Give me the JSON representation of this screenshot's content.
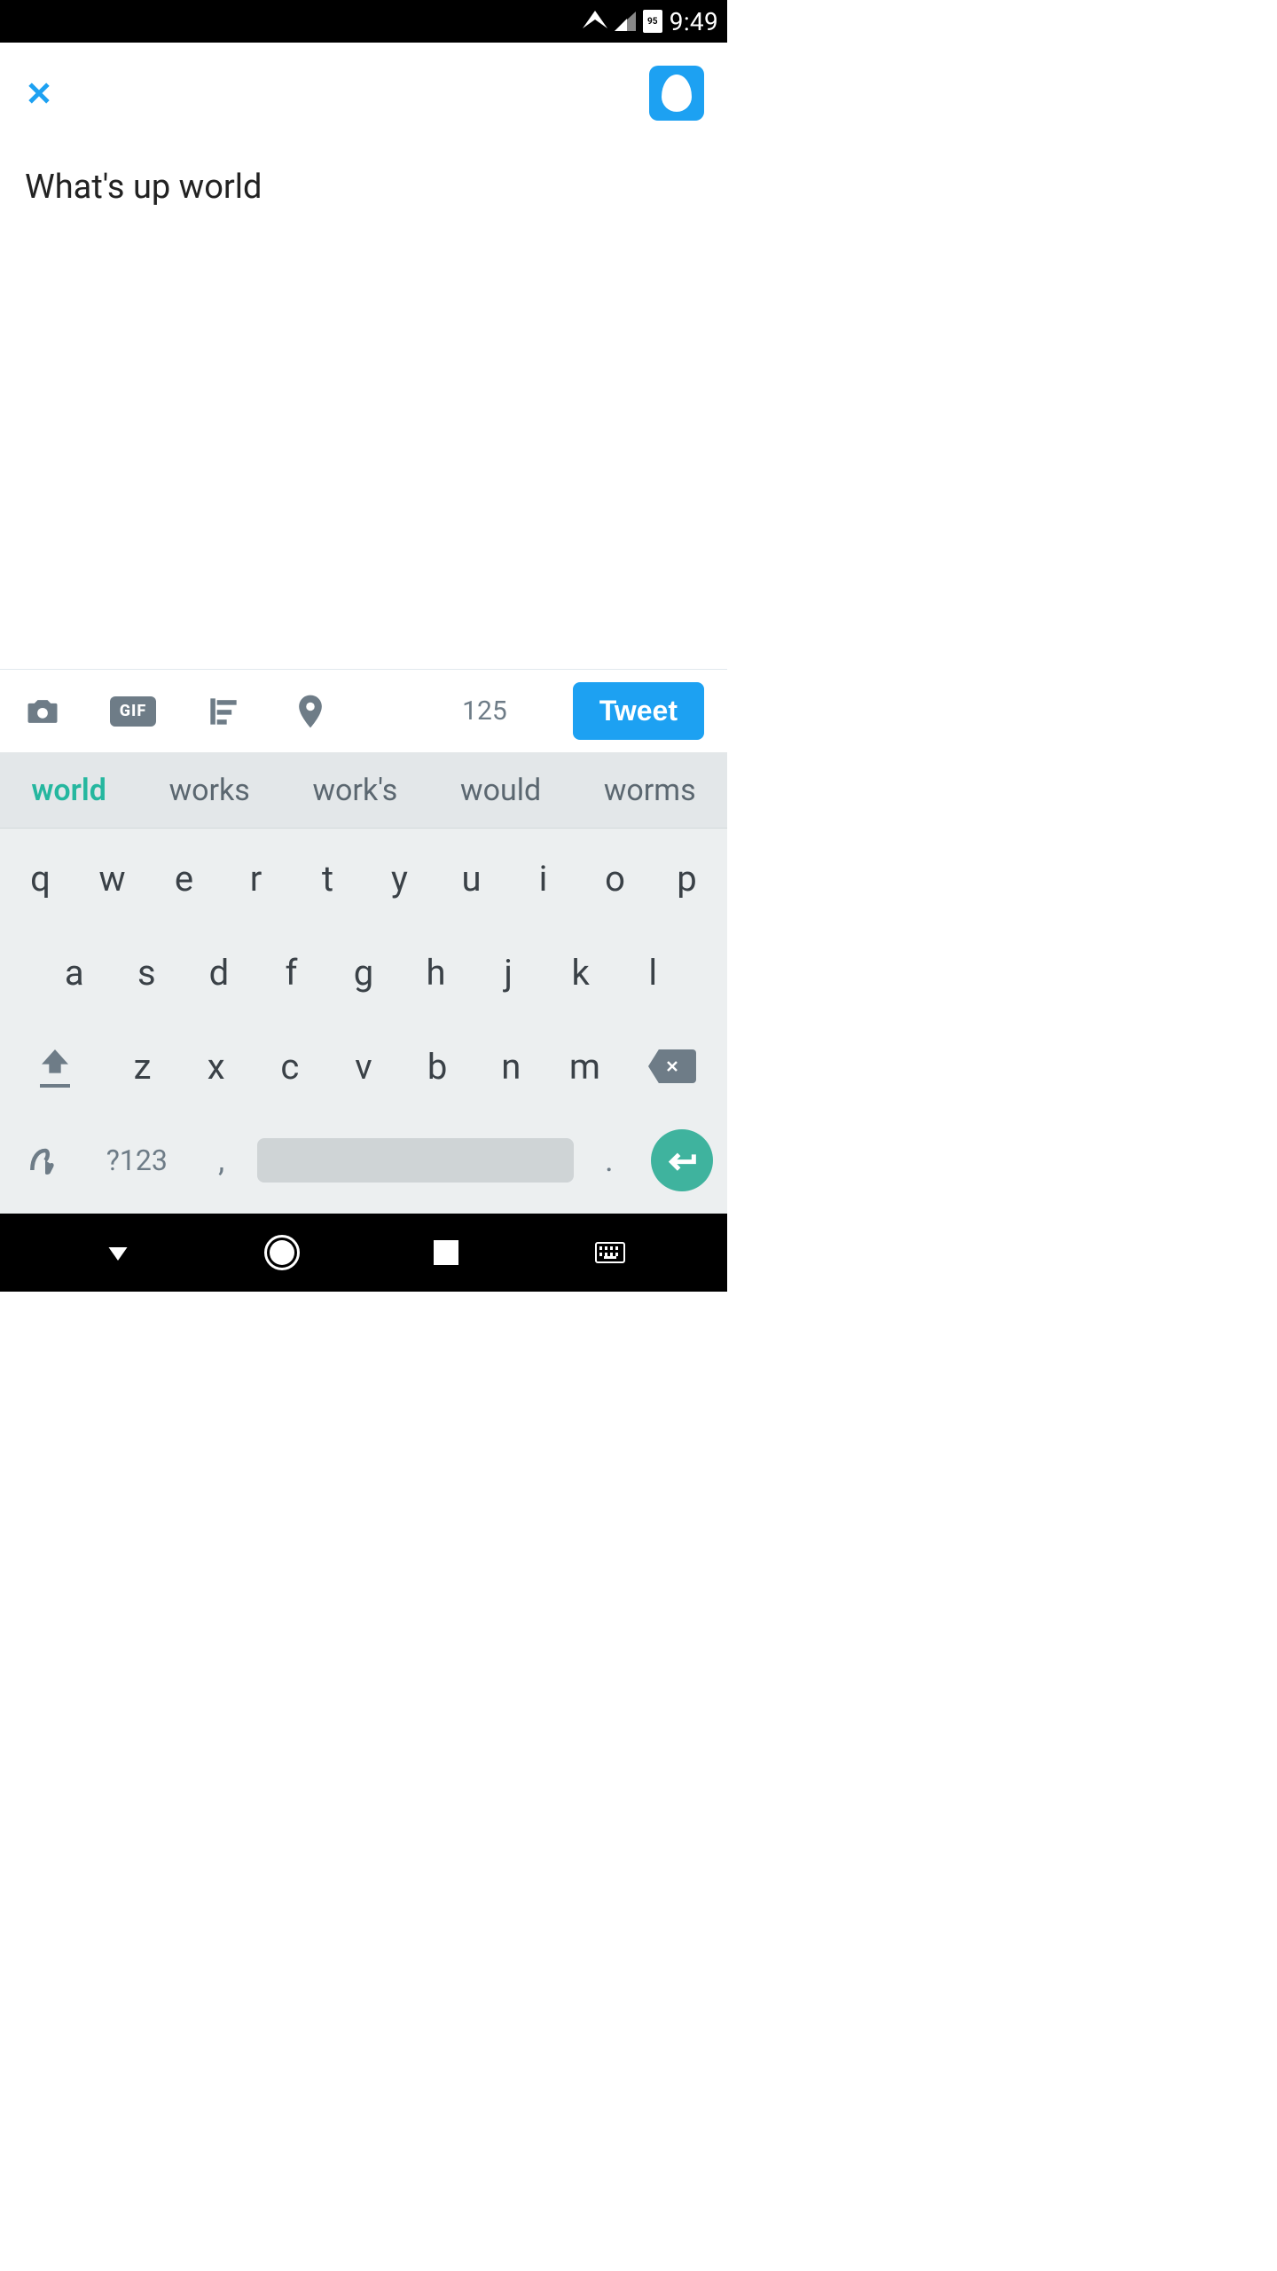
{
  "status_bar": {
    "battery_pct": "95",
    "time": "9:49"
  },
  "header": {
    "close_icon": "close-icon",
    "avatar_icon": "egg-avatar"
  },
  "compose": {
    "text": "What's up world"
  },
  "toolbar": {
    "camera_icon": "camera-icon",
    "gif_label": "GIF",
    "poll_icon": "poll-icon",
    "location_icon": "location-icon",
    "char_count": "125",
    "tweet_label": "Tweet"
  },
  "suggestions": [
    "world",
    "works",
    "work's",
    "would",
    "worms"
  ],
  "keyboard": {
    "row1": [
      "q",
      "w",
      "e",
      "r",
      "t",
      "y",
      "u",
      "i",
      "o",
      "p"
    ],
    "row2": [
      "a",
      "s",
      "d",
      "f",
      "g",
      "h",
      "j",
      "k",
      "l"
    ],
    "row3": [
      "z",
      "x",
      "c",
      "v",
      "b",
      "n",
      "m"
    ],
    "numsym": "?123",
    "comma": ",",
    "period": "."
  }
}
